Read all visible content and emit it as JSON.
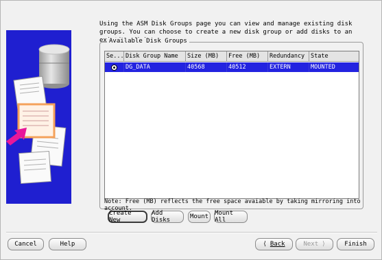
{
  "description": "Using the ASM Disk Groups page you can view and manage existing disk groups. You can choose to create a new disk group or add disks to an existing disk group.",
  "group_title": "Available Disk Groups",
  "table": {
    "columns": [
      "Se...",
      "Disk Group Name",
      "Size (MB)",
      "Free (MB)",
      "Redundancy",
      "State"
    ],
    "rows": [
      {
        "selected": true,
        "name": "DG_DATA",
        "size": "40568",
        "free": "40512",
        "redundancy": "EXTERN",
        "state": "MOUNTED"
      }
    ]
  },
  "note": "Note: Free (MB) reflects the free space avaiable by taking mirroring into account.",
  "actions": {
    "create_new": "Create New",
    "add_disks": "Add Disks",
    "mount": "Mount",
    "mount_all": "Mount All"
  },
  "footer": {
    "cancel": "Cancel",
    "help": "Help",
    "back": "Back",
    "next": "Next",
    "finish": "Finish"
  },
  "colors": {
    "selection": "#2323e0",
    "illustration_bg": "#1f1fd0",
    "arrow": "#e8179a"
  }
}
